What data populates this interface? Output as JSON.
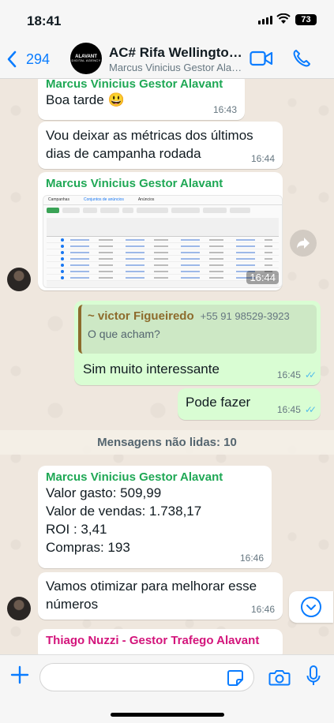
{
  "status_bar": {
    "time": "18:41",
    "battery": "73"
  },
  "header": {
    "back_count": "294",
    "avatar_text": "ALAVANT",
    "avatar_subtext": "DIGITAL AGENCY",
    "title": "AC# Rifa Wellington...",
    "subtitle": "Marcus Vinicius Gestor Alavant, Thiago Nuzzi..."
  },
  "messages": [
    {
      "sender": "Marcus Vinicius Gestor Alavant",
      "text": "Boa tarde 😃",
      "time": "16:43"
    },
    {
      "text_line1": "Vou deixar as métricas dos últimos",
      "text_line2": "dias de campanha rodada",
      "time": "16:44"
    },
    {
      "sender": "Marcus Vinicius Gestor Alavant",
      "time": "16:44",
      "thumb_tabs": [
        "Campanhas",
        "Conjuntos de anúncios",
        "Anúncios"
      ]
    },
    {
      "quote_name": "~ victor Figueiredo",
      "quote_phone": "+55 91 98529-3923",
      "quote_text": "O que acham?",
      "text": "Sim muito interessante",
      "time": "16:45"
    },
    {
      "text": "Pode fazer",
      "time": "16:45"
    },
    {
      "sender": "Marcus Vinicius Gestor Alavant",
      "lines": [
        "Valor gasto: 509,99",
        "Valor de vendas: 1.738,17",
        "ROI : 3,41",
        "Compras: 193"
      ],
      "time": "16:46"
    },
    {
      "text_line1": "Vamos otimizar para melhorar esse",
      "text_line2": "números",
      "time": "16:46"
    },
    {
      "sender": "Thiago Nuzzi - Gestor Trafego Alavant"
    }
  ],
  "unread_label": "Mensagens não lidas: 10",
  "input": {
    "placeholder": ""
  },
  "colors": {
    "accent": "#0a7cff",
    "sender_green": "#1fa855",
    "sender_pink": "#d3147b",
    "outgoing": "#d9fdd3"
  }
}
